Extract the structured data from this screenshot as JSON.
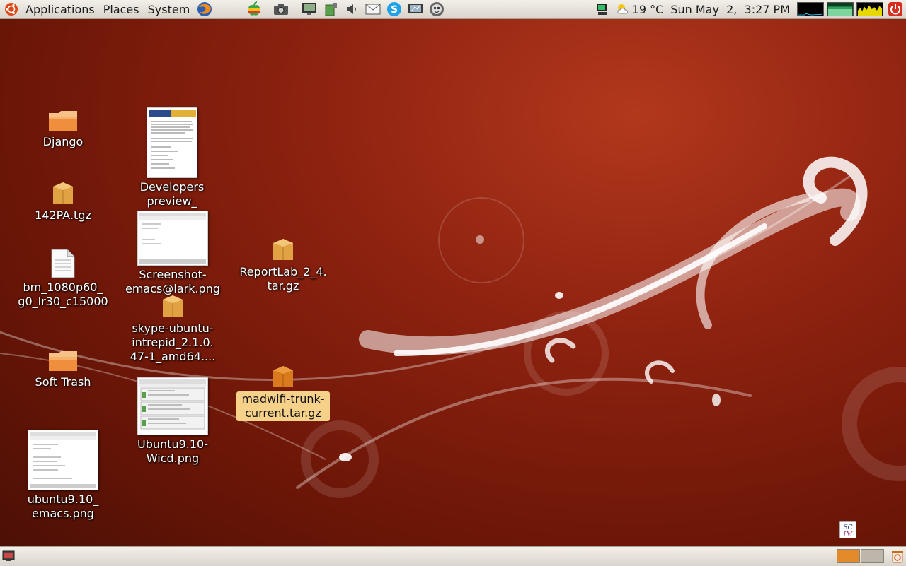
{
  "top_panel": {
    "menus": {
      "applications": "Applications",
      "places": "Places",
      "system": "System"
    },
    "launchers": [
      "firefox-icon",
      "apple-icon",
      "camera-icon",
      "monitor-icon",
      "battery-icon",
      "volume-icon",
      "mail-icon",
      "skype-icon",
      "network-icon",
      "tux-icon"
    ],
    "weather": {
      "temperature": "19 °C",
      "icon": "partly-cloudy-icon"
    },
    "clock": "Sun May  2,  3:27 PM",
    "colors": {
      "panel": "#e4e0d8",
      "cpu_monitor": "#000000",
      "memory_monitor": "#2e9e58",
      "net_monitor": "#e6d800"
    }
  },
  "desktop": {
    "icons": [
      {
        "label": "Django",
        "type": "folder-icon"
      },
      {
        "label": "142PA.tgz",
        "type": "archive-icon"
      },
      {
        "label": "bm_1080p60_ g0_lr30_c15000",
        "type": "document-icon"
      },
      {
        "label": "Soft Trash",
        "type": "folder-icon"
      },
      {
        "label": "ubuntu9.10_ emacs.png",
        "type": "image-thumbnail"
      },
      {
        "label": "Developers preview_",
        "type": "document-thumbnail"
      },
      {
        "label": "Screenshot-emacs@lark.png",
        "type": "image-thumbnail"
      },
      {
        "label": "skype-ubuntu-intrepid_2.1.0. 47-1_amd64....",
        "type": "archive-icon"
      },
      {
        "label": "Ubuntu9.10-Wicd.png",
        "type": "image-thumbnail"
      },
      {
        "label": "ReportLab_2_4. tar.gz",
        "type": "archive-icon"
      },
      {
        "label": "madwifi-trunk-current.tar.gz",
        "type": "archive-icon",
        "selected": true
      }
    ],
    "scim_label": "SC IM"
  },
  "bottom_panel": {
    "workspaces": [
      {
        "active": true,
        "color": "#e38a2b"
      },
      {
        "active": false,
        "color": "#bdb6aa"
      }
    ]
  }
}
